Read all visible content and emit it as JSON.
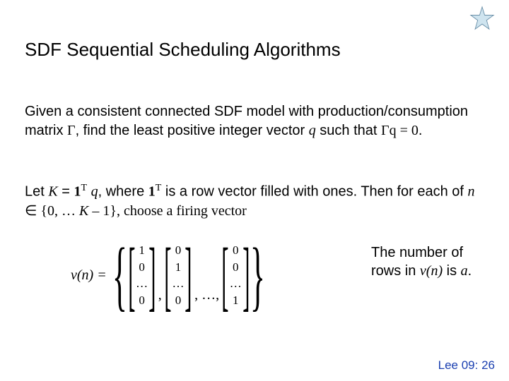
{
  "title": "SDF Sequential Scheduling Algorithms",
  "para1": {
    "t1": "Given a consistent connected SDF model with production/consumption matrix ",
    "gamma": "Γ",
    "t2": ", find the least positive integer vector ",
    "q": "q",
    "t3": " such that ",
    "eq": "Γq = 0",
    "t4": "."
  },
  "para2": {
    "t1": "Let ",
    "K": "K",
    "t2": " = ",
    "one1": "1",
    "T1": "T",
    "sp1": " ",
    "q": "q",
    "t3": ", where ",
    "one2": "1",
    "T2": "T",
    "t4": " is a row vector filled with ones. Then for each of ",
    "n": "n",
    "t5": " ∈ {0, … ",
    "K2": "K",
    "t6": " – 1}, choose a firing vector"
  },
  "eq": {
    "lhs": "v(n) = ",
    "dots": "…",
    "comma": ",",
    "ellipsis": ", …,",
    "c1": {
      "r1": "1",
      "r2": "0",
      "r3": "…",
      "r4": "0"
    },
    "c2": {
      "r1": "0",
      "r2": "1",
      "r3": "…",
      "r4": "0"
    },
    "c3": {
      "r1": "0",
      "r2": "0",
      "r3": "…",
      "r4": "1"
    }
  },
  "sidenote": {
    "t1": "The number of rows in ",
    "vn": "v(n)",
    "t2": " is ",
    "a": "a",
    "t3": "."
  },
  "footer": "Lee 09: 26"
}
